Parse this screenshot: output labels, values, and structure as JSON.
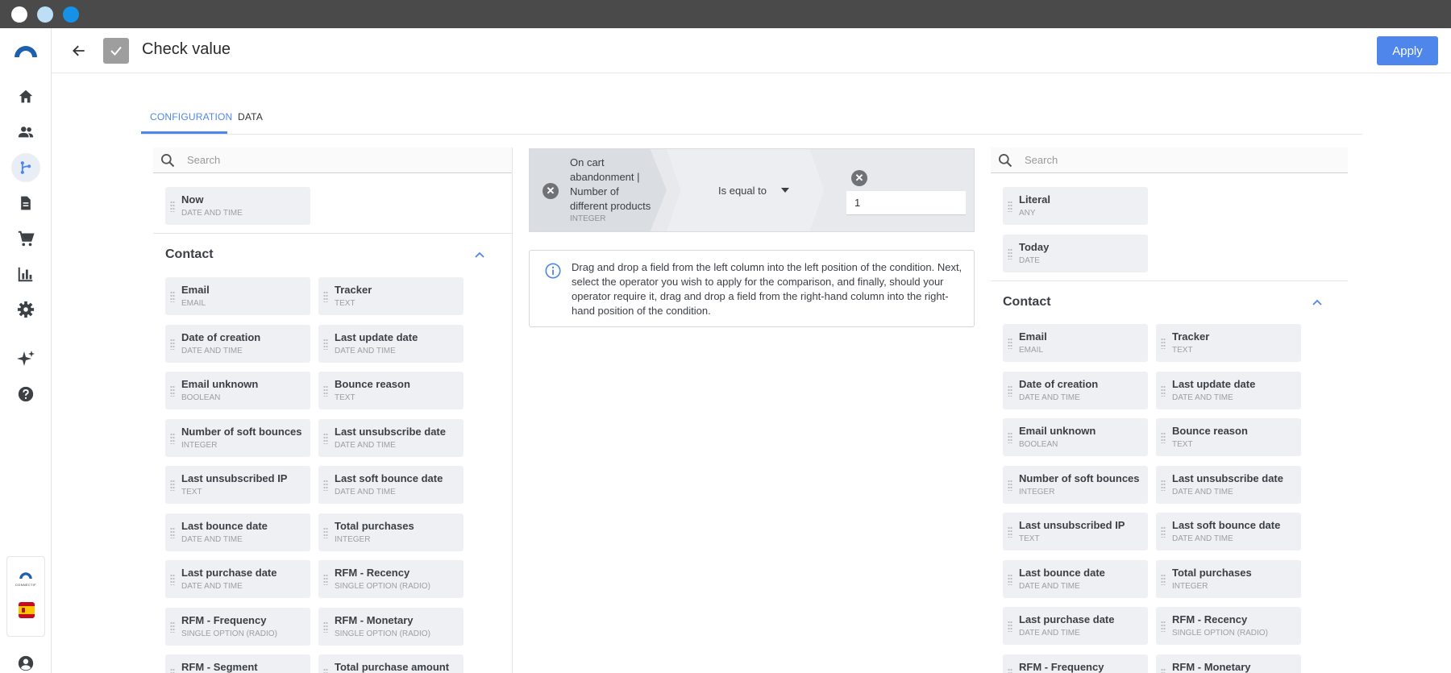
{
  "window": {
    "dots": [
      {
        "name": "window-close-dot",
        "color": "#ffffff"
      },
      {
        "name": "window-minimize-dot",
        "color": "#bcdff7"
      },
      {
        "name": "window-maximize-dot",
        "color": "#1591e6"
      }
    ]
  },
  "colors": {
    "accent": "#4f86ec",
    "sidebar_icon": "#3d4146",
    "chip_bg": "#eef0f3"
  },
  "sidebar": {
    "items": [
      {
        "name": "logo-icon",
        "active": false
      },
      {
        "name": "home-icon",
        "active": false
      },
      {
        "name": "contacts-icon",
        "active": false
      },
      {
        "name": "workflow-icon",
        "active": true
      },
      {
        "name": "documents-icon",
        "active": false
      },
      {
        "name": "cart-icon",
        "active": false
      },
      {
        "name": "analytics-icon",
        "active": false
      },
      {
        "name": "settings-icon",
        "active": false
      },
      {
        "name": "ai-sparkle-icon",
        "active": false
      },
      {
        "name": "help-icon",
        "active": false
      },
      {
        "name": "brand-logo-icon",
        "active": false
      },
      {
        "name": "spain-flag-icon",
        "active": false
      },
      {
        "name": "account-icon",
        "active": false
      }
    ],
    "brand_text": "CONNECTIF"
  },
  "header": {
    "title": "Check value",
    "apply_label": "Apply"
  },
  "tabs": [
    {
      "label": "CONFIGURATION",
      "active": true
    },
    {
      "label": "DATA",
      "active": false
    }
  ],
  "left_panel": {
    "search_placeholder": "Search",
    "top_fields": [
      {
        "name": "Now",
        "type": "DATE AND TIME"
      }
    ],
    "section_title": "Contact",
    "fields": [
      {
        "name": "Email",
        "type": "EMAIL"
      },
      {
        "name": "Tracker",
        "type": "TEXT"
      },
      {
        "name": "Date of creation",
        "type": "DATE AND TIME"
      },
      {
        "name": "Last update date",
        "type": "DATE AND TIME"
      },
      {
        "name": "Email unknown",
        "type": "BOOLEAN"
      },
      {
        "name": "Bounce reason",
        "type": "TEXT"
      },
      {
        "name": "Number of soft bounces",
        "type": "INTEGER"
      },
      {
        "name": "Last unsubscribe date",
        "type": "DATE AND TIME"
      },
      {
        "name": "Last unsubscribed IP",
        "type": "TEXT"
      },
      {
        "name": "Last soft bounce date",
        "type": "DATE AND TIME"
      },
      {
        "name": "Last bounce date",
        "type": "DATE AND TIME"
      },
      {
        "name": "Total purchases",
        "type": "INTEGER"
      },
      {
        "name": "Last purchase date",
        "type": "DATE AND TIME"
      },
      {
        "name": "RFM - Recency",
        "type": "SINGLE OPTION (RADIO)"
      },
      {
        "name": "RFM - Frequency",
        "type": "SINGLE OPTION (RADIO)"
      },
      {
        "name": "RFM - Monetary",
        "type": "SINGLE OPTION (RADIO)"
      },
      {
        "name": "RFM - Segment",
        "type": ""
      },
      {
        "name": "Total purchase amount",
        "type": ""
      }
    ]
  },
  "condition": {
    "left_field_name": "On cart abandonment | Number of different products",
    "left_field_type": "INTEGER",
    "operator": "Is equal to",
    "right_value": "1",
    "info_text": "Drag and drop a field from the left column into the left position of the condition. Next, select the operator you wish to apply for the comparison, and finally, should your operator require it, drag and drop a field from the right-hand column into the right-hand position of the condition."
  },
  "right_panel": {
    "search_placeholder": "Search",
    "top_fields": [
      {
        "name": "Literal",
        "type": "ANY"
      },
      {
        "name": "Today",
        "type": "DATE"
      }
    ],
    "section_title": "Contact",
    "fields": [
      {
        "name": "Email",
        "type": "EMAIL"
      },
      {
        "name": "Tracker",
        "type": "TEXT"
      },
      {
        "name": "Date of creation",
        "type": "DATE AND TIME"
      },
      {
        "name": "Last update date",
        "type": "DATE AND TIME"
      },
      {
        "name": "Email unknown",
        "type": "BOOLEAN"
      },
      {
        "name": "Bounce reason",
        "type": "TEXT"
      },
      {
        "name": "Number of soft bounces",
        "type": "INTEGER"
      },
      {
        "name": "Last unsubscribe date",
        "type": "DATE AND TIME"
      },
      {
        "name": "Last unsubscribed IP",
        "type": "TEXT"
      },
      {
        "name": "Last soft bounce date",
        "type": "DATE AND TIME"
      },
      {
        "name": "Last bounce date",
        "type": "DATE AND TIME"
      },
      {
        "name": "Total purchases",
        "type": "INTEGER"
      },
      {
        "name": "Last purchase date",
        "type": "DATE AND TIME"
      },
      {
        "name": "RFM - Recency",
        "type": "SINGLE OPTION (RADIO)"
      },
      {
        "name": "RFM - Frequency",
        "type": ""
      },
      {
        "name": "RFM - Monetary",
        "type": ""
      }
    ]
  }
}
